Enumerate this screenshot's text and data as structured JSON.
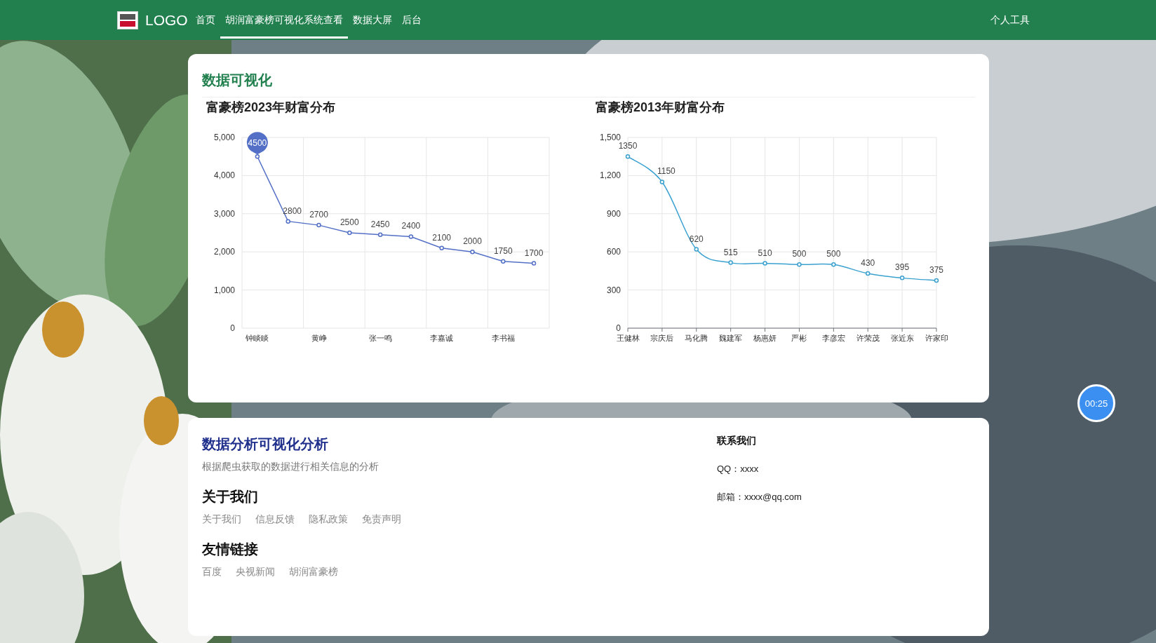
{
  "nav": {
    "logo": "LOGO",
    "items": [
      {
        "label": "首页",
        "selected": false
      },
      {
        "label": "胡润富豪榜可视化系统查看",
        "selected": true
      },
      {
        "label": "数据大屏",
        "selected": false
      },
      {
        "label": "后台",
        "selected": false
      }
    ],
    "user_menu": "个人工具"
  },
  "visualization": {
    "title": "数据可视化",
    "charts": [
      {
        "title": "富豪榜2023年财富分布",
        "chart_data": {
          "type": "line",
          "grid": true,
          "categories": [
            "钟睒睒",
            null,
            "黄峥",
            null,
            "张一鸣",
            null,
            "李嘉诚",
            null,
            "李书福",
            null
          ],
          "series": [
            {
              "color": "#5470c6",
              "marker": true,
              "values": [
                4500,
                2800,
                2700,
                2500,
                2450,
                2400,
                2100,
                2000,
                1750,
                1700
              ]
            }
          ],
          "ylim": [
            0,
            5000
          ],
          "yticks": [
            0,
            {
              "value": 1000,
              "label": "1,000"
            },
            {
              "value": 2000,
              "label": "2,000"
            },
            {
              "value": 3000,
              "label": "3,000"
            },
            {
              "value": 4000,
              "label": "4,000"
            },
            {
              "value": 5000,
              "label": "5,000"
            }
          ],
          "data_labels": true
        }
      },
      {
        "title": "富豪榜2013年财富分布",
        "chart_data": {
          "type": "line",
          "grid": true,
          "categories": [
            "王健林",
            "宗庆后",
            "马化腾",
            "魏建军",
            "杨惠妍",
            "严彬",
            "李彦宏",
            "许荣茂",
            "张近东",
            "许家印"
          ],
          "series": [
            {
              "color": "#3ba1d0",
              "marker": true,
              "values": [
                1350,
                1150,
                620,
                515,
                510,
                500,
                500,
                430,
                395,
                375
              ]
            }
          ],
          "ylim": [
            0,
            1500
          ],
          "yticks": [
            0,
            300,
            600,
            900,
            {
              "value": 1200,
              "label": "1,200"
            },
            {
              "value": 1500,
              "label": "1,500"
            }
          ],
          "data_labels": true
        }
      }
    ]
  },
  "footer": {
    "title": "数据分析可视化分析",
    "subtitle": "根据爬虫获取的数据进行相关信息的分析",
    "sections": [
      {
        "heading": "关于我们",
        "links": [
          "关于我们",
          "信息反馈",
          "隐私政策",
          "免责声明"
        ]
      },
      {
        "heading": "友情链接",
        "links": [
          "百度",
          "央视新闻",
          "胡润富豪榜"
        ]
      }
    ],
    "contact": {
      "heading": "联系我们",
      "lines": [
        "QQ：xxxx",
        "邮箱：xxxx@qq.com"
      ]
    }
  },
  "timer": "00:25"
}
